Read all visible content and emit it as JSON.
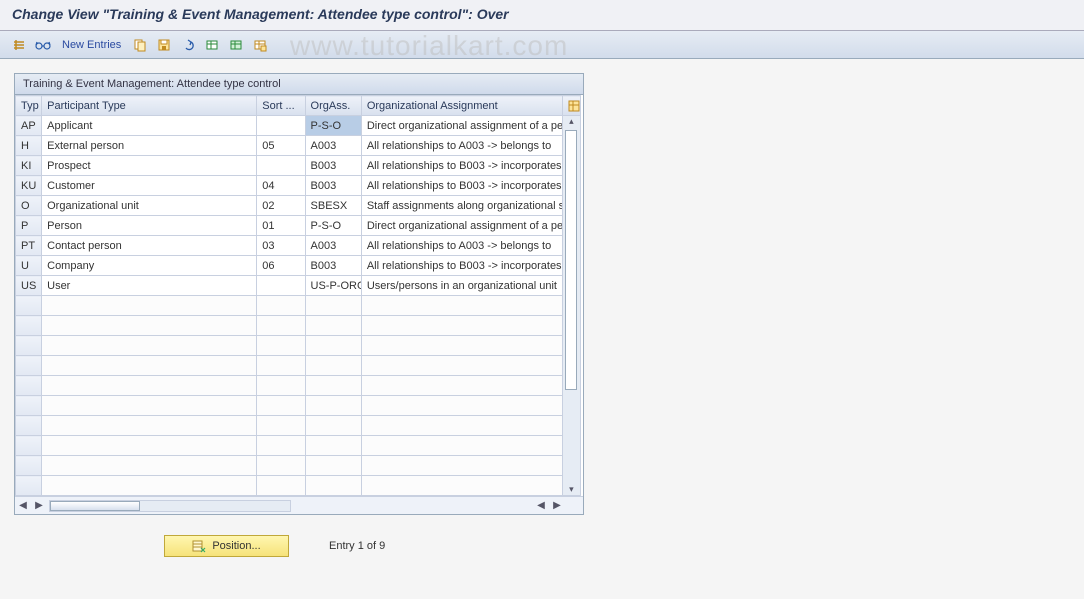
{
  "title": "Change View \"Training & Event Management: Attendee type control\": Over",
  "watermark": "www.tutorialkart.com",
  "toolbar": {
    "new_entries_label": "New Entries"
  },
  "grid": {
    "panel_title": "Training & Event Management: Attendee type control",
    "headers": {
      "typ": "Typ",
      "participant_type": "Participant Type",
      "sort": "Sort ...",
      "orgass": "OrgAss.",
      "org_assignment": "Organizational Assignment"
    },
    "rows": [
      {
        "typ": "AP",
        "ptype": "Applicant",
        "sort": "",
        "orgass": "P-S-O",
        "orgassign": "Direct organizational assignment of a perso",
        "selected": true
      },
      {
        "typ": "H",
        "ptype": "External person",
        "sort": "05",
        "orgass": "A003",
        "orgassign": "All relationships to A003 -> belongs to"
      },
      {
        "typ": "KI",
        "ptype": "Prospect",
        "sort": "",
        "orgass": "B003",
        "orgassign": "All relationships to B003 -> incorporates"
      },
      {
        "typ": "KU",
        "ptype": "Customer",
        "sort": "04",
        "orgass": "B003",
        "orgassign": "All relationships to B003 -> incorporates"
      },
      {
        "typ": "O",
        "ptype": "Organizational unit",
        "sort": "02",
        "orgass": "SBESX",
        "orgassign": "Staff assignments along organizational struc"
      },
      {
        "typ": "P",
        "ptype": "Person",
        "sort": "01",
        "orgass": "P-S-O",
        "orgassign": "Direct organizational assignment of a perso"
      },
      {
        "typ": "PT",
        "ptype": "Contact person",
        "sort": "03",
        "orgass": "A003",
        "orgassign": "All relationships to A003 -> belongs to"
      },
      {
        "typ": "U",
        "ptype": "Company",
        "sort": "06",
        "orgass": "B003",
        "orgassign": "All relationships to B003 -> incorporates"
      },
      {
        "typ": "US",
        "ptype": "User",
        "sort": "",
        "orgass": "US-P-ORG",
        "orgassign": "Users/persons in an organizational unit"
      }
    ],
    "empty_rows": 10
  },
  "footer": {
    "position_label": "Position...",
    "entry_text": "Entry 1 of 9"
  }
}
